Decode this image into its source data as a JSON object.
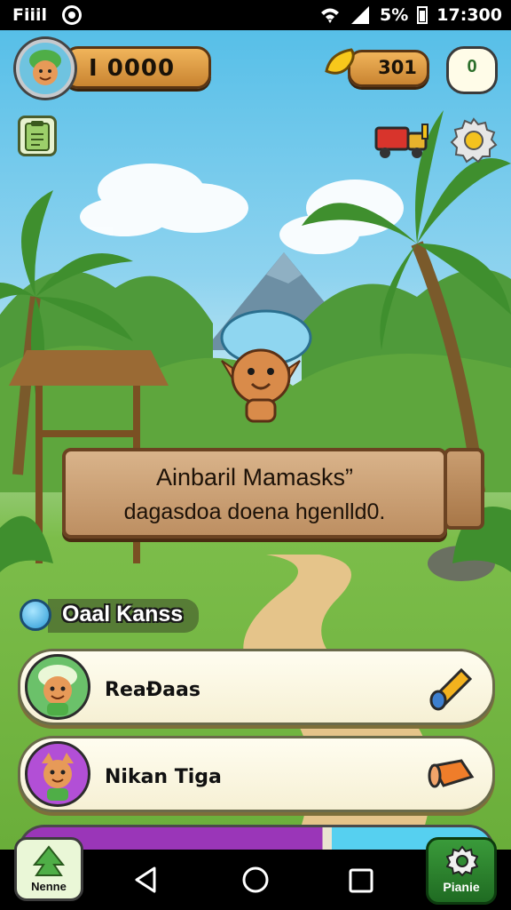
{
  "status_bar": {
    "carrier": "Fiiil",
    "battery": "5%",
    "time": "17:300"
  },
  "header": {
    "coins": "I 0000",
    "gems": "301",
    "round_button": "0"
  },
  "sign": {
    "title": "Ainbaril Mamasks”",
    "subtitle": "dagasdoa doena hgenlld0."
  },
  "section": {
    "title": "Oaal Kanss"
  },
  "list": [
    {
      "name": "ReaĐaas",
      "item_icon": "horn-icon"
    },
    {
      "name": "Nikan Tiga",
      "item_icon": "horn-icon"
    }
  ],
  "bottom": {
    "home_label": "Nenne",
    "prize_label": "Pianie"
  },
  "colors": {
    "sky": "#57bfe8",
    "grass": "#6aae3a",
    "wood": "#c98431",
    "purple": "#9a36b8"
  }
}
